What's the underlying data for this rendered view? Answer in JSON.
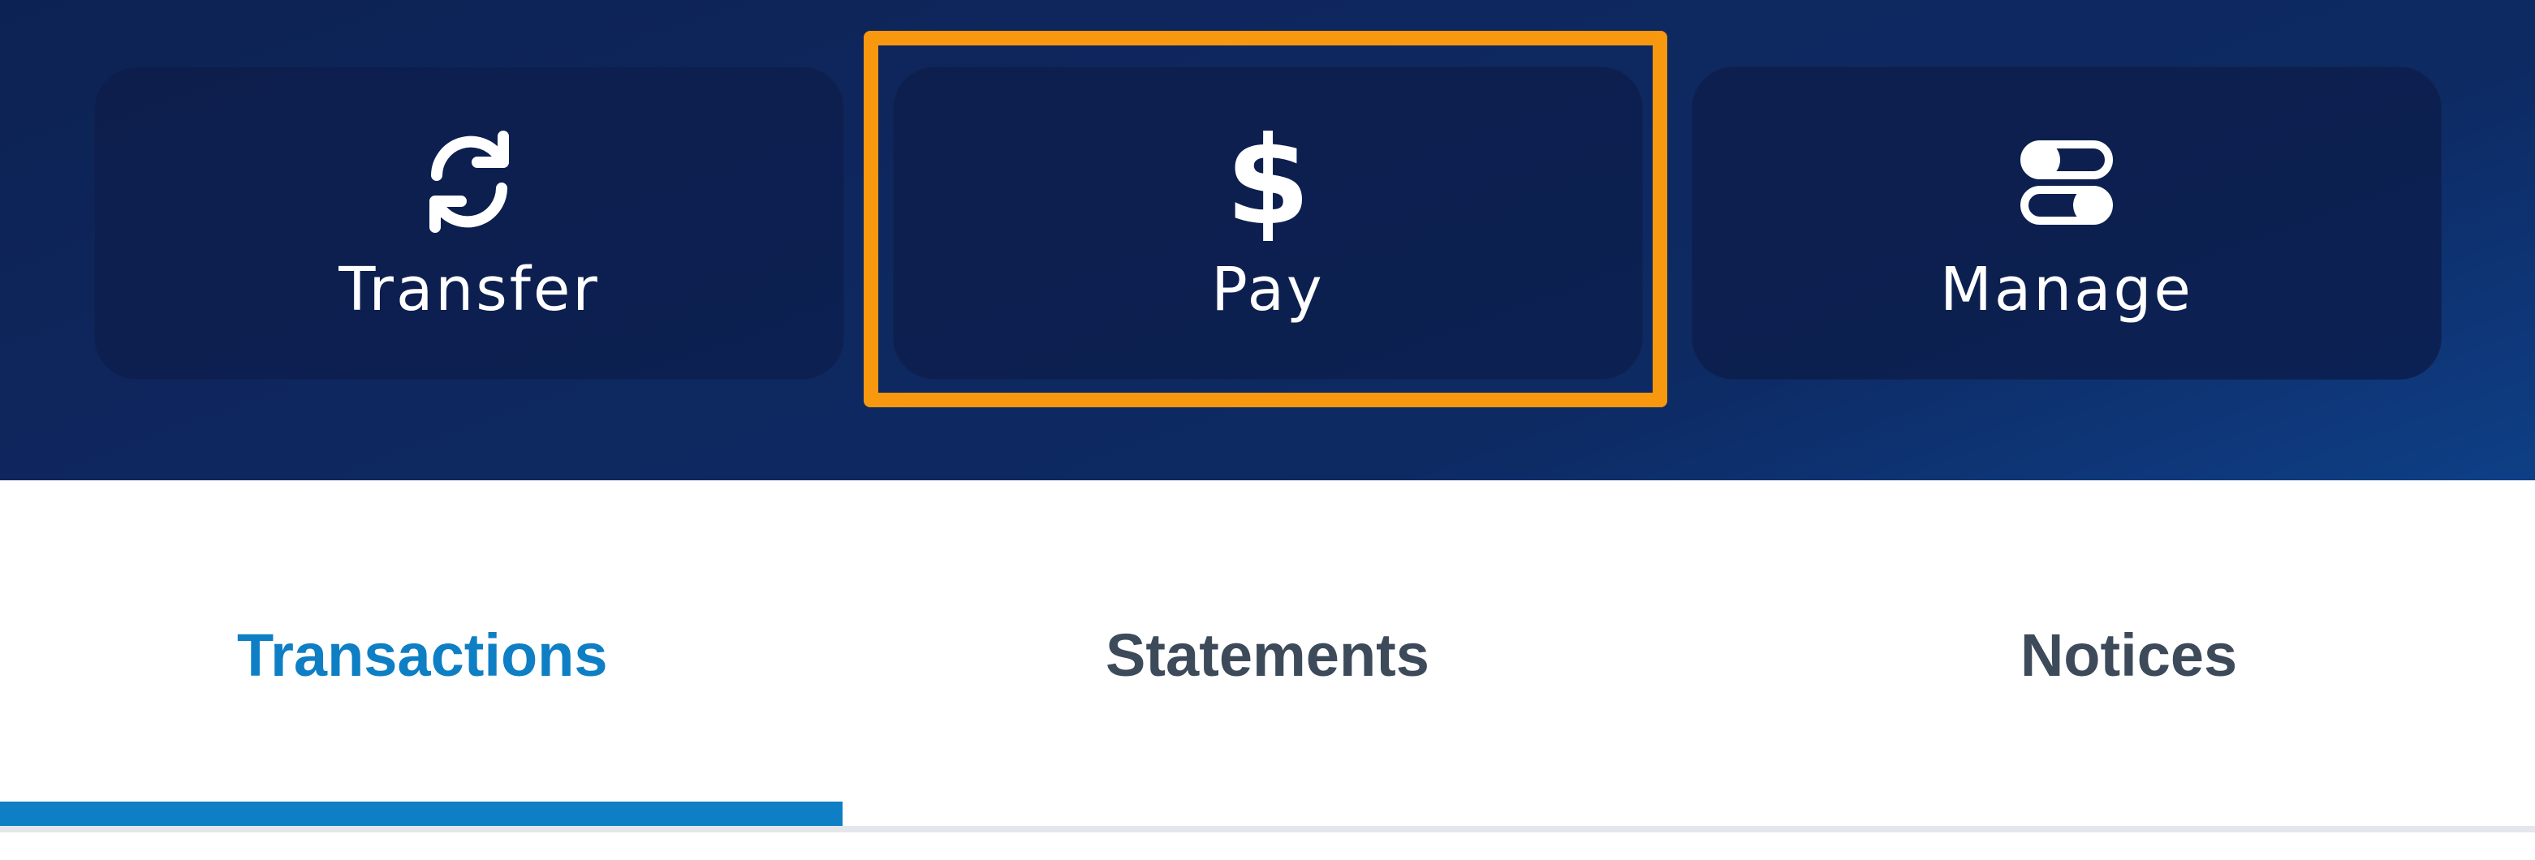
{
  "actions": {
    "transfer_label": "Transfer",
    "pay_label": "Pay",
    "manage_label": "Manage",
    "pay_symbol": "$"
  },
  "tabs": {
    "items": [
      {
        "label": "Transactions",
        "active": true
      },
      {
        "label": "Statements",
        "active": false
      },
      {
        "label": "Notices",
        "active": false
      }
    ]
  },
  "colors": {
    "hero_background": "#0d2860",
    "card_background": "#0c1f50",
    "highlight_border": "#f7980f",
    "active_tab": "#0e7fc4",
    "inactive_tab": "#3d4a5a"
  },
  "icons": {
    "transfer": "refresh-icon",
    "pay": "dollar-icon",
    "manage": "toggles-icon"
  }
}
